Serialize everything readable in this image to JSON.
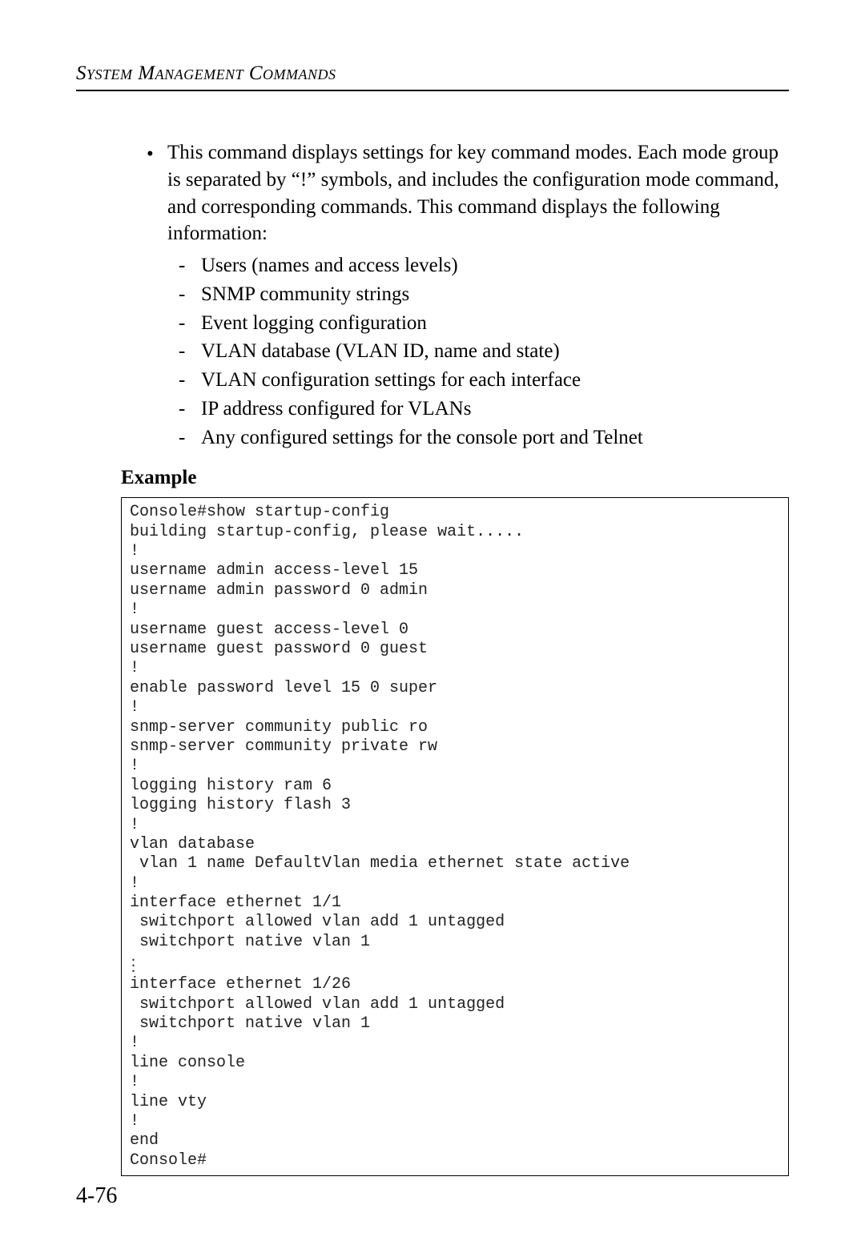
{
  "header": "System Management Commands",
  "intro": "This command displays settings for key command modes. Each mode group is separated by “!” symbols, and includes the configuration mode command, and corresponding commands. This command displays the following information:",
  "sub_items": [
    "Users (names and access levels)",
    "SNMP community strings",
    "Event logging configuration",
    "VLAN database (VLAN ID, name and state)",
    "VLAN configuration settings for each interface",
    "IP address configured for VLANs",
    "Any configured settings for the console port and Telnet"
  ],
  "example_label": "Example",
  "code_part1": "Console#show startup-config\nbuilding startup-config, please wait.....\n!\nusername admin access-level 15\nusername admin password 0 admin\n!\nusername guest access-level 0\nusername guest password 0 guest\n!\nenable password level 15 0 super\n!\nsnmp-server community public ro\nsnmp-server community private rw\n!\nlogging history ram 6\nlogging history flash 3\n!\nvlan database\n vlan 1 name DefaultVlan media ethernet state active\n!\ninterface ethernet 1/1\n switchport allowed vlan add 1 untagged\n switchport native vlan 1",
  "code_part2": "interface ethernet 1/26\n switchport allowed vlan add 1 untagged\n switchport native vlan 1\n!\nline console\n!\nline vty\n!\nend\nConsole#",
  "page_number": "4-76"
}
